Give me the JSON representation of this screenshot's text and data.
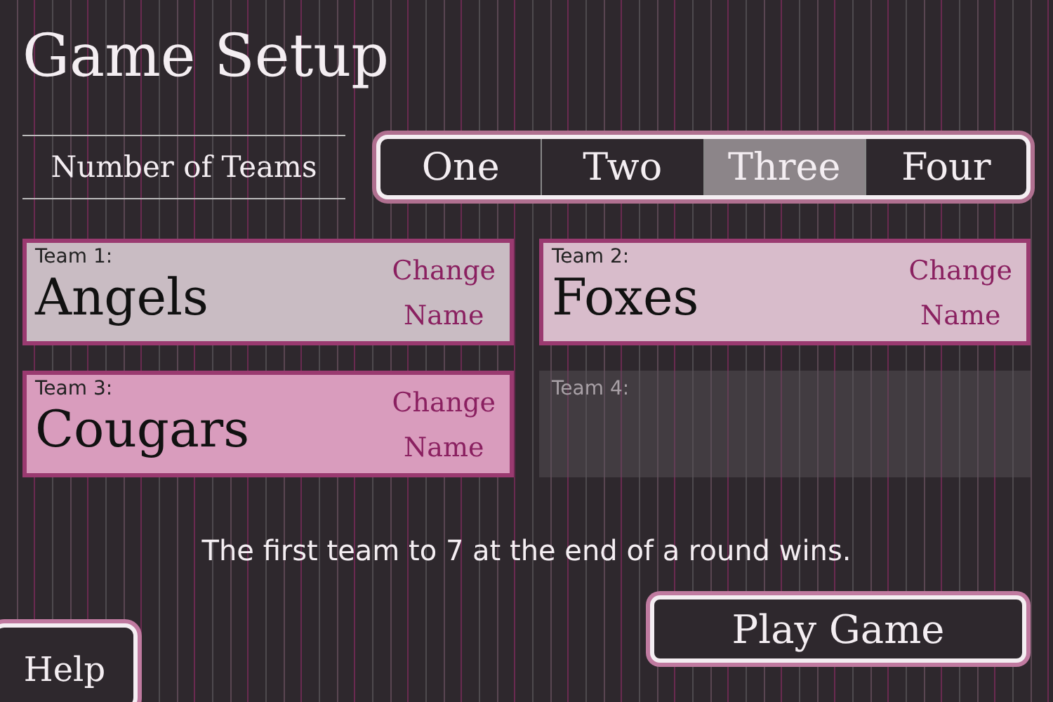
{
  "title": "Game Setup",
  "team_count": {
    "label": "Number of Teams",
    "options": [
      {
        "label": "One",
        "selected": false
      },
      {
        "label": "Two",
        "selected": false
      },
      {
        "label": "Three",
        "selected": true
      },
      {
        "label": "Four",
        "selected": false
      }
    ]
  },
  "teams": [
    {
      "label": "Team 1:",
      "name": "Angels",
      "change_button": [
        "Change",
        "Name"
      ],
      "color": "#c9bcc3",
      "disabled": false
    },
    {
      "label": "Team 2:",
      "name": "Foxes",
      "change_button": [
        "Change",
        "Name"
      ],
      "color": "#d8bccb",
      "disabled": false
    },
    {
      "label": "Team 3:",
      "name": "Cougars",
      "change_button": [
        "Change",
        "Name"
      ],
      "color": "#d99cbd",
      "disabled": false
    },
    {
      "label": "Team 4:",
      "disabled": true
    }
  ],
  "rule_text": "The first team to 7 at the end of a round wins.",
  "play_button": "Play Game",
  "help_button": "Help"
}
